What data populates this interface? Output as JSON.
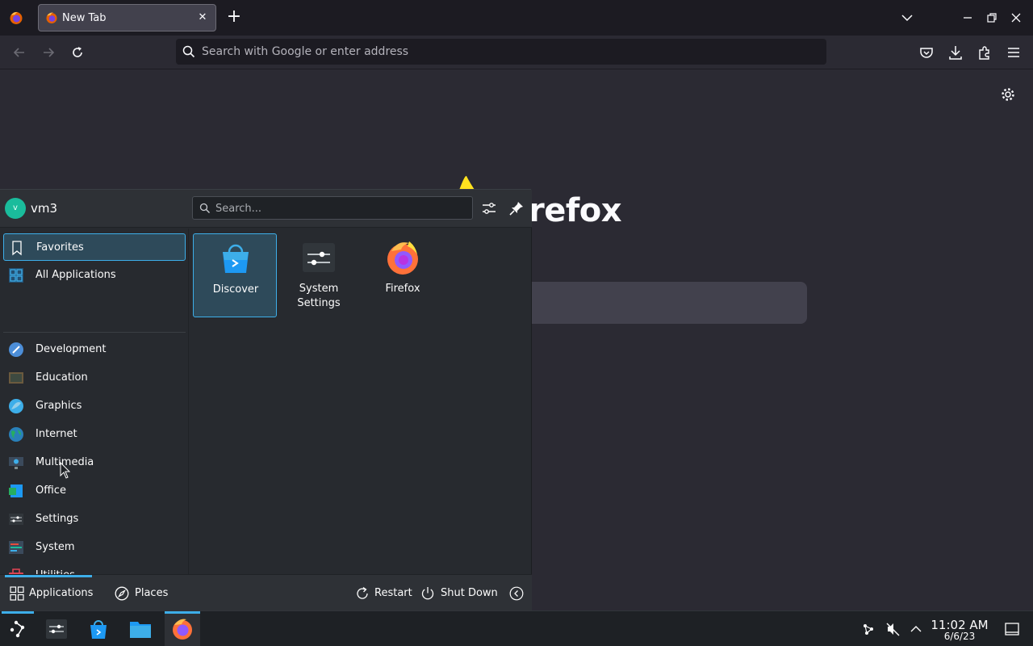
{
  "browser": {
    "tab": {
      "title": "New Tab",
      "close": "✕"
    },
    "new_tab": "+",
    "urlbar": {
      "placeholder": "Search with Google or enter address"
    },
    "page": {
      "wordmark": "refox"
    }
  },
  "launcher": {
    "user": {
      "name": "vm3",
      "initial": "v"
    },
    "search": {
      "placeholder": "Search..."
    },
    "categories": [
      {
        "label": "Favorites",
        "icon": "bookmark-icon"
      },
      {
        "label": "All Applications",
        "icon": "grid-icon"
      },
      {
        "label": "Development",
        "icon": "development-icon"
      },
      {
        "label": "Education",
        "icon": "education-icon"
      },
      {
        "label": "Graphics",
        "icon": "graphics-icon"
      },
      {
        "label": "Internet",
        "icon": "globe-icon"
      },
      {
        "label": "Multimedia",
        "icon": "multimedia-icon"
      },
      {
        "label": "Office",
        "icon": "office-icon"
      },
      {
        "label": "Settings",
        "icon": "settings-icon"
      },
      {
        "label": "System",
        "icon": "system-icon"
      },
      {
        "label": "Utilities",
        "icon": "toolbox-icon"
      }
    ],
    "apps": [
      {
        "label": "Discover",
        "icon": "discover-icon"
      },
      {
        "label": "System Settings",
        "icon": "system-settings-icon"
      },
      {
        "label": "Firefox",
        "icon": "firefox-icon"
      }
    ],
    "footer": {
      "applications": "Applications",
      "places": "Places",
      "restart": "Restart",
      "shutdown": "Shut Down"
    }
  },
  "panel": {
    "clock": {
      "time": "11:02 AM",
      "date": "6/6/23"
    }
  },
  "colors": {
    "accent": "#3daee9",
    "browser_bg": "#2b2a33",
    "tabbar_bg": "#1c1b22",
    "launcher_bg": "#272a2f",
    "panel_bg": "#1e2125"
  }
}
